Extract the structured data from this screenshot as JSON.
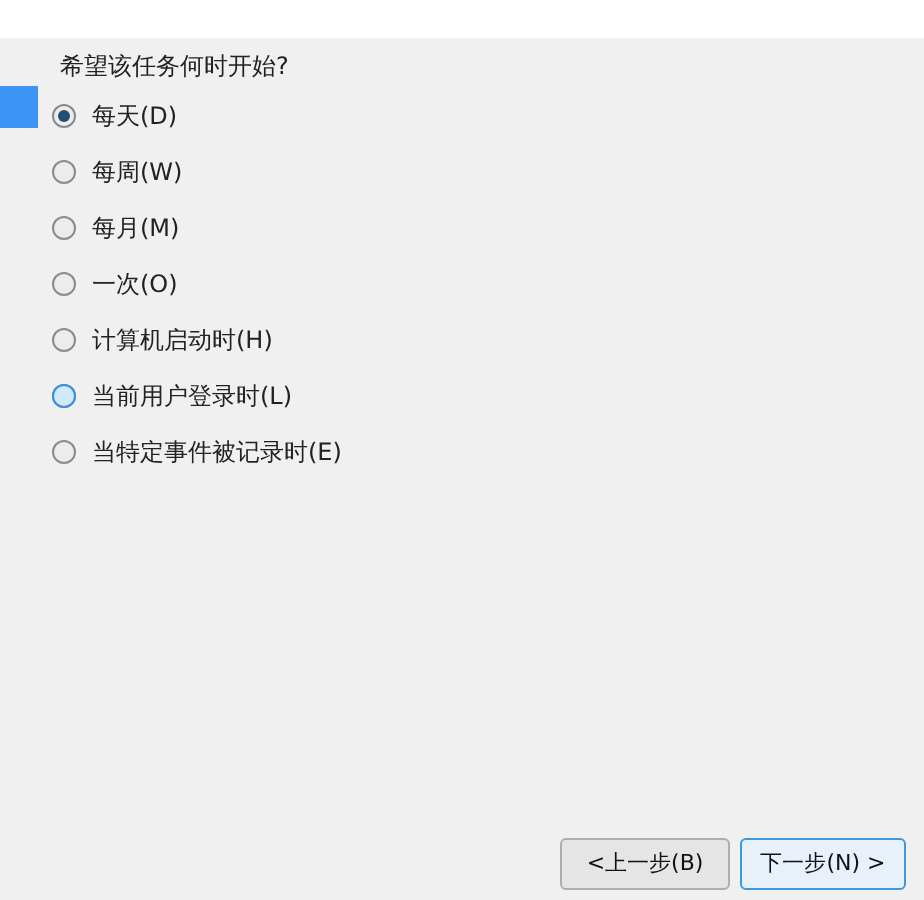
{
  "question": "希望该任务何时开始?",
  "options": [
    {
      "label": "每天(D)",
      "selected": true,
      "hovered": false
    },
    {
      "label": "每周(W)",
      "selected": false,
      "hovered": false
    },
    {
      "label": "每月(M)",
      "selected": false,
      "hovered": false
    },
    {
      "label": "一次(O)",
      "selected": false,
      "hovered": false
    },
    {
      "label": "计算机启动时(H)",
      "selected": false,
      "hovered": false
    },
    {
      "label": "当前用户登录时(L)",
      "selected": false,
      "hovered": true
    },
    {
      "label": "当特定事件被记录时(E)",
      "selected": false,
      "hovered": false
    }
  ],
  "buttons": [
    {
      "label": "<上一步(B)",
      "default": false
    },
    {
      "label": "下一步(N) >",
      "default": true
    }
  ]
}
